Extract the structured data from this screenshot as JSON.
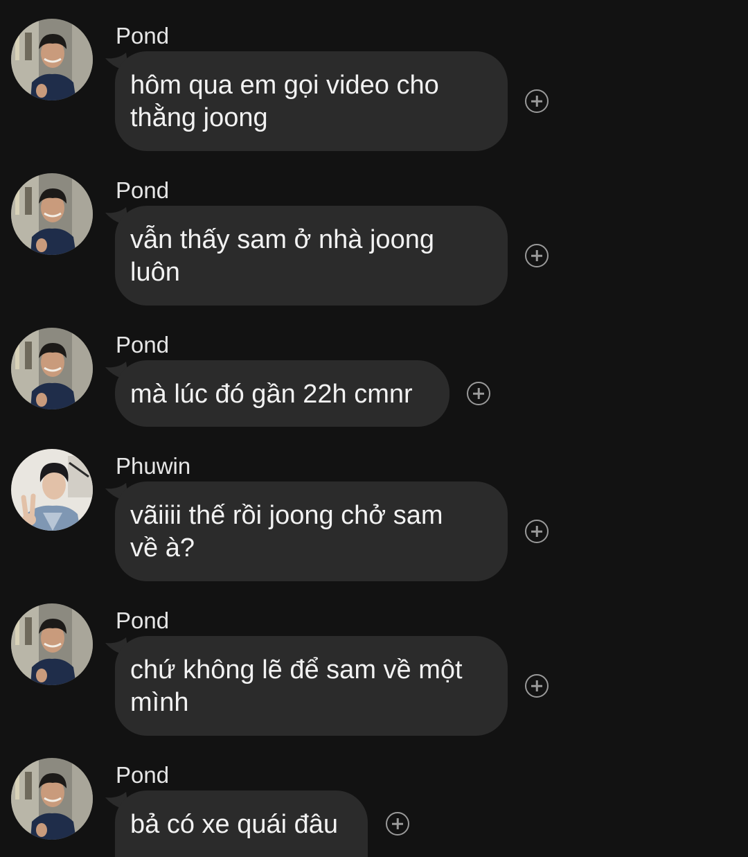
{
  "messages": [
    {
      "sender": "Pond",
      "avatar": "pond-avatar",
      "text": "hôm qua em gọi video cho\nthằng joong"
    },
    {
      "sender": "Pond",
      "avatar": "pond-avatar",
      "text": "vẫn thấy sam ở nhà joong\nluôn"
    },
    {
      "sender": "Pond",
      "avatar": "pond-avatar",
      "text": "mà lúc đó gần 22h cmnr"
    },
    {
      "sender": "Phuwin",
      "avatar": "phuwin-avatar",
      "text": "vãiiii thế rồi joong chở sam\nvề à?"
    },
    {
      "sender": "Pond",
      "avatar": "pond-avatar",
      "text": "chứ không lẽ để sam về một\nmình"
    },
    {
      "sender": "Pond",
      "avatar": "pond-avatar",
      "text": "bả có xe quái đâu"
    }
  ],
  "icons": {
    "reaction": "add-reaction-icon"
  },
  "colors": {
    "background": "#121212",
    "bubble": "#2b2b2b",
    "text": "#f2f2f2",
    "icon": "#9a9a9a"
  }
}
